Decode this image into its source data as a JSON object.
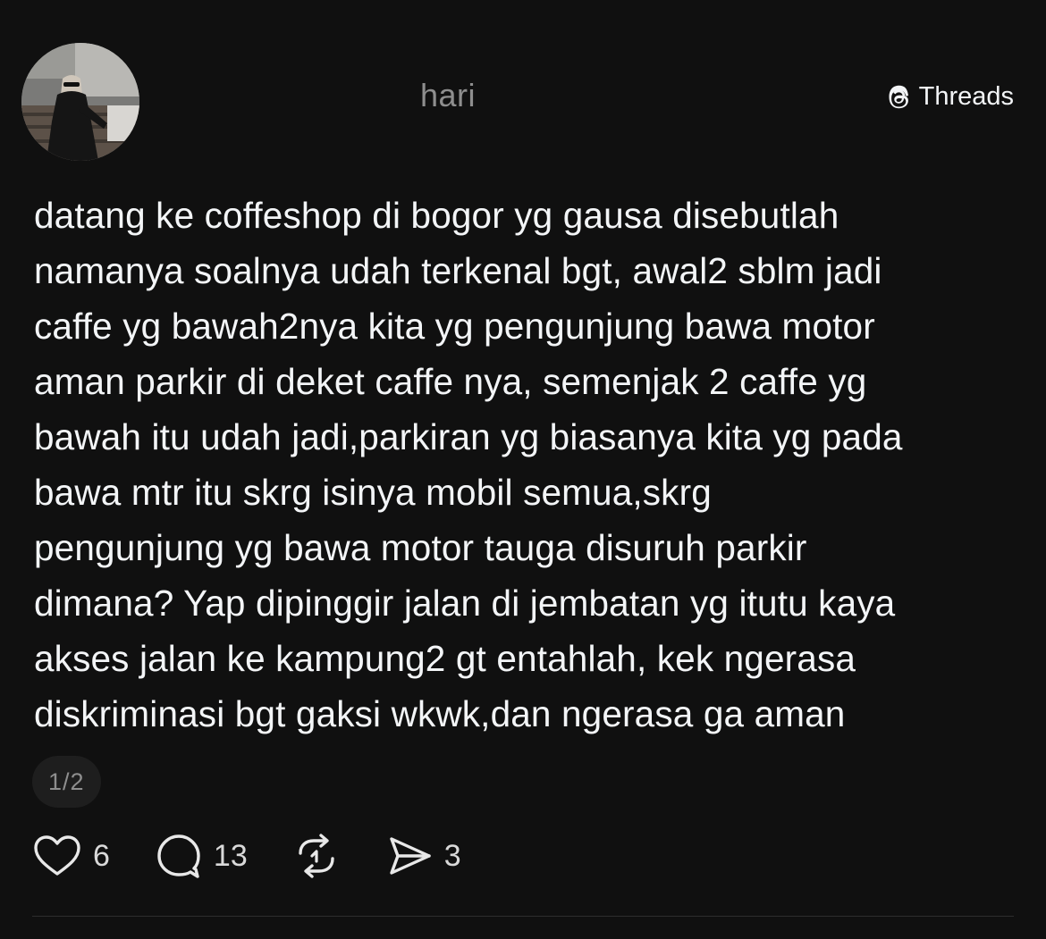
{
  "header": {
    "username": "hari",
    "brand_label": "Threads",
    "avatar_icon": "profile-photo"
  },
  "post": {
    "text": "datang ke coffeshop di bogor yg gausa disebutlah\nnamanya soalnya udah terkenal bgt, awal2 sblm jadi\ncaffe yg bawah2nya kita yg pengunjung bawa motor\naman parkir di deket caffe nya, semenjak 2 caffe yg\nbawah itu udah jadi,parkiran yg biasanya kita yg pada\nbawa mtr itu skrg isinya mobil semua,skrg\npengunjung yg bawa motor tauga disuruh parkir\ndimana? Yap dipinggir jalan di jembatan yg itutu kaya\nakses jalan ke kampung2 gt entahlah, kek ngerasa\ndiskriminasi bgt gaksi wkwk,dan ngerasa ga aman",
    "page_indicator": "1/2"
  },
  "actions": {
    "like": {
      "icon": "heart-icon",
      "count": "6"
    },
    "reply": {
      "icon": "comment-icon",
      "count": "13"
    },
    "repost": {
      "icon": "repost-icon",
      "count": ""
    },
    "share": {
      "icon": "send-icon",
      "count": "3"
    }
  },
  "colors": {
    "background": "#101010",
    "text": "#f3f5f7",
    "muted": "#8e8e8e"
  }
}
